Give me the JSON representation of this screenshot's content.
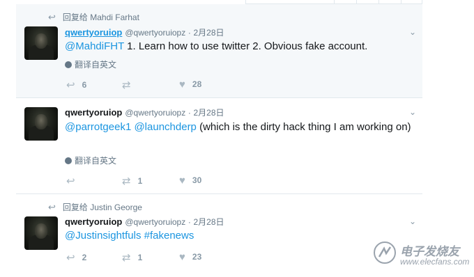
{
  "tweets": [
    {
      "reply_to": "回复给 Mahdi Farhat",
      "name": "qwertyoruiop",
      "handle": "@qwertyoruiopz",
      "sep": "·",
      "time": "2月28日",
      "mention": "@MahdiFHT",
      "text": " 1. Learn how to use twitter 2. Obvious fake account.",
      "translate": "翻译自英文",
      "reply_count": "6",
      "retweet_count": "",
      "like_count": "28"
    },
    {
      "name": "qwertyoruiop",
      "handle": "@qwertyoruiopz",
      "sep": "·",
      "time": "2月28日",
      "mention1": "@parrotgeek1",
      "mention2": "@launchderp",
      "text": " (which is the dirty hack thing I am working on)",
      "translate": "翻译自英文",
      "reply_count": "",
      "retweet_count": "1",
      "like_count": "30"
    },
    {
      "reply_to": "回复给 Justin George",
      "name": "qwertyoruiop",
      "handle": "@qwertyoruiopz",
      "sep": "·",
      "time": "2月28日",
      "mention": "@Justinsightfuls",
      "hashtag": "#fakenews",
      "reply_count": "2",
      "retweet_count": "1",
      "like_count": "23"
    }
  ],
  "icons": {
    "reply": "reply-arrow",
    "retweet": "retweet-arrows",
    "like": "heart",
    "caret": "chevron-down",
    "globe": "globe"
  },
  "colors": {
    "link": "#1b95e0",
    "muted": "#657786",
    "highlight_bg": "#f5f8fa"
  },
  "watermark": {
    "cn": "电子发烧友",
    "url": "www.elecfans.com"
  }
}
